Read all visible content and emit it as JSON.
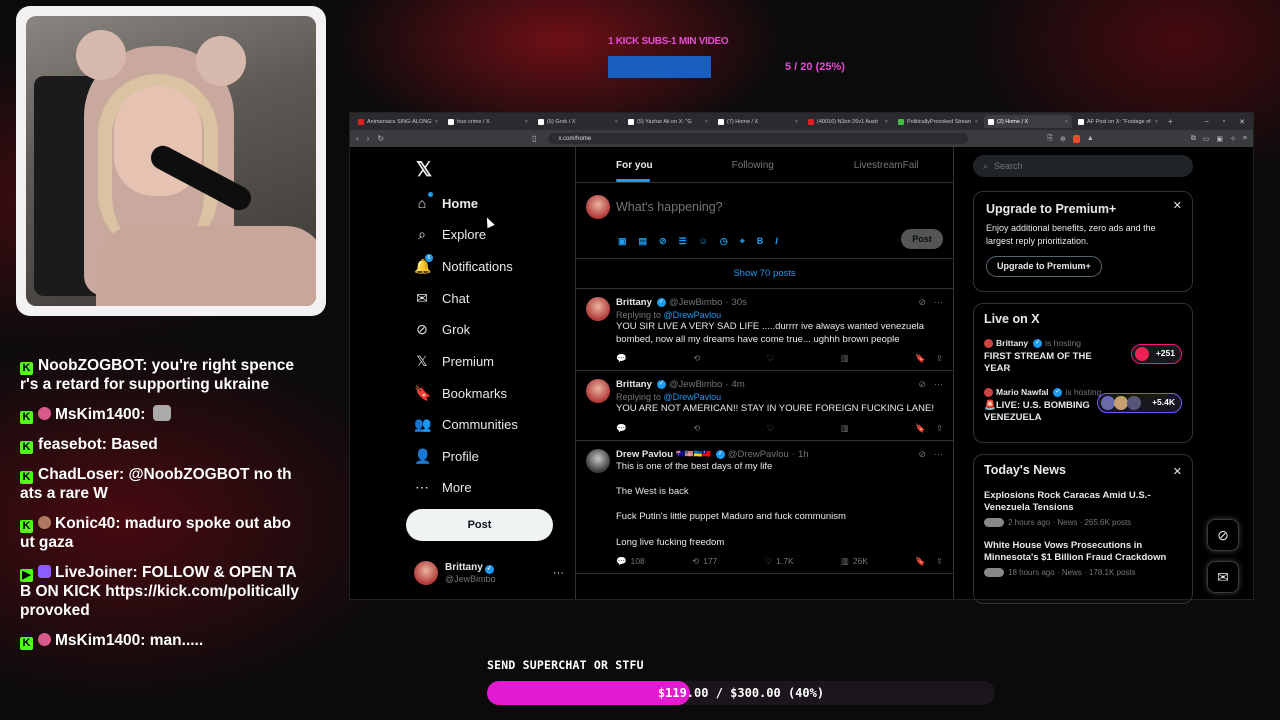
{
  "colors": {
    "accent_blue": "#1d9bf0",
    "kick_green": "#53fc18",
    "goal_magenta": "#e21bd0",
    "sub_bar_blue": "#1a5fc0"
  },
  "sub_goal": {
    "label": "1 KICK SUBS-1 MIN VIDEO",
    "count": "5 / 20 (25%)",
    "progress": 0.25
  },
  "chat": [
    {
      "user": "NoobZOGBOT",
      "text": "you're right spencer's a retard for supporting ukraine",
      "badge": "kick",
      "avatar": ""
    },
    {
      "user": "MsKim1400",
      "text": "",
      "badge": "kick",
      "avatar": "pink",
      "emote": "cat-emote"
    },
    {
      "user": "feasebot",
      "text": "Based",
      "badge": "kick",
      "avatar": ""
    },
    {
      "user": "ChadLoser",
      "text": "@NoobZOGBOT no thats a rare W",
      "badge": "kick",
      "avatar": ""
    },
    {
      "user": "Konic40",
      "text": "maduro spoke out about gaza",
      "badge": "kick",
      "avatar": "brown"
    },
    {
      "user": "LiveJoiner",
      "text": "FOLLOW & OPEN TAB ON KICK https://kick.com/politicallyprovoked",
      "badge": "play",
      "avatar": "purple"
    },
    {
      "user": "MsKim1400",
      "text": "man.....",
      "badge": "kick",
      "avatar": "pink"
    }
  ],
  "browser": {
    "tabs": [
      {
        "label": "Animaniacs SING-ALONG",
        "icon": "youtube",
        "active": false
      },
      {
        "label": "true crime / X",
        "icon": "x",
        "active": false
      },
      {
        "label": "(5) Grok / X",
        "icon": "x",
        "active": false
      },
      {
        "label": "(5) Yazhar Ali on X: \"G",
        "icon": "x",
        "active": false
      },
      {
        "label": "(7) Home / X",
        "icon": "x",
        "active": false
      },
      {
        "label": "(40016) N3on 26v1 Austr",
        "icon": "youtube",
        "active": false
      },
      {
        "label": "PoliticallyProvoked Strean",
        "icon": "kick",
        "active": false
      },
      {
        "label": "(2) Home / X",
        "icon": "x",
        "active": true
      },
      {
        "label": "AF Post on X: \"Footage of",
        "icon": "x",
        "active": false
      }
    ],
    "url": "x.com/home"
  },
  "x_nav": {
    "items": [
      {
        "label": "Home",
        "icon": "home-icon",
        "glyph": "⌂"
      },
      {
        "label": "Explore",
        "icon": "search-icon",
        "glyph": "⌕"
      },
      {
        "label": "Notifications",
        "icon": "bell-icon",
        "glyph": "🔔",
        "badge": "6"
      },
      {
        "label": "Chat",
        "icon": "chat-icon",
        "glyph": "✉"
      },
      {
        "label": "Grok",
        "icon": "grok-icon",
        "glyph": "⊘"
      },
      {
        "label": "Premium",
        "icon": "x-icon",
        "glyph": "𝕏"
      },
      {
        "label": "Bookmarks",
        "icon": "bookmark-icon",
        "glyph": "🔖"
      },
      {
        "label": "Communities",
        "icon": "communities-icon",
        "glyph": "👥"
      },
      {
        "label": "Profile",
        "icon": "profile-icon",
        "glyph": "👤"
      },
      {
        "label": "More",
        "icon": "more-icon",
        "glyph": "⋯"
      }
    ],
    "post_label": "Post",
    "account": {
      "name": "Brittany",
      "handle": "@JewBimbo"
    }
  },
  "feed": {
    "tabs": [
      "For you",
      "Following",
      "LivestreamFail"
    ],
    "compose_placeholder": "What's happening?",
    "compose_post": "Post",
    "show_posts": "Show 70 posts",
    "tweets": [
      {
        "name": "Brittany",
        "handle": "@JewBimbo",
        "time": "30s",
        "reply_to": "@DrewPavlou",
        "text": "YOU SIR LIVE A VERY SAD LIFE .....durrrr ive always wanted venezuela bombed, now all my dreams have come true... ughhh brown people",
        "replies": "",
        "reposts": "",
        "likes": "",
        "views": ""
      },
      {
        "name": "Brittany",
        "handle": "@JewBimbo",
        "time": "4m",
        "reply_to": "@DrewPavlou",
        "text": "YOU ARE NOT AMERICAN!! STAY IN YOURE FOREIGN FUCKING LANE!",
        "replies": "",
        "reposts": "",
        "likes": "",
        "views": ""
      },
      {
        "name": "Drew Pavlou",
        "handle": "@DrewPavlou",
        "time": "1h",
        "reply_to": "",
        "text": "This is one of the best days of my life\n\nThe West is back\n\nFuck Putin's little puppet Maduro and fuck communism\n\nLong live fucking freedom",
        "replies": "108",
        "reposts": "177",
        "likes": "1.7K",
        "views": "26K"
      }
    ]
  },
  "sidebar": {
    "search_placeholder": "Search",
    "premium": {
      "title": "Upgrade to Premium+",
      "desc": "Enjoy additional benefits, zero ads and the largest reply prioritization.",
      "button": "Upgrade to Premium+"
    },
    "live": {
      "title": "Live on X",
      "items": [
        {
          "host": "Brittany",
          "suffix": "is hosting",
          "title": "FIRST STREAM OF THE YEAR",
          "count": "+251"
        },
        {
          "host": "Mario Nawfal",
          "suffix": "is hosting",
          "title": "🚨LIVE: U.S. BOMBING VENEZUELA",
          "count": "+5.4K"
        }
      ]
    },
    "news": {
      "title": "Today's News",
      "items": [
        {
          "headline": "Explosions Rock Caracas Amid U.S.-Venezuela Tensions",
          "meta": "2 hours ago · News · 265.6K posts"
        },
        {
          "headline": "White House Vows Prosecutions in Minnesota's $1 Billion Fraud Crackdown",
          "meta": "18 hours ago · News · 178.1K posts"
        }
      ]
    }
  },
  "superchat": {
    "label": "SEND SUPERCHAT OR STFU",
    "text": "$119.00 / $300.00 (40%)",
    "progress": 0.4
  }
}
